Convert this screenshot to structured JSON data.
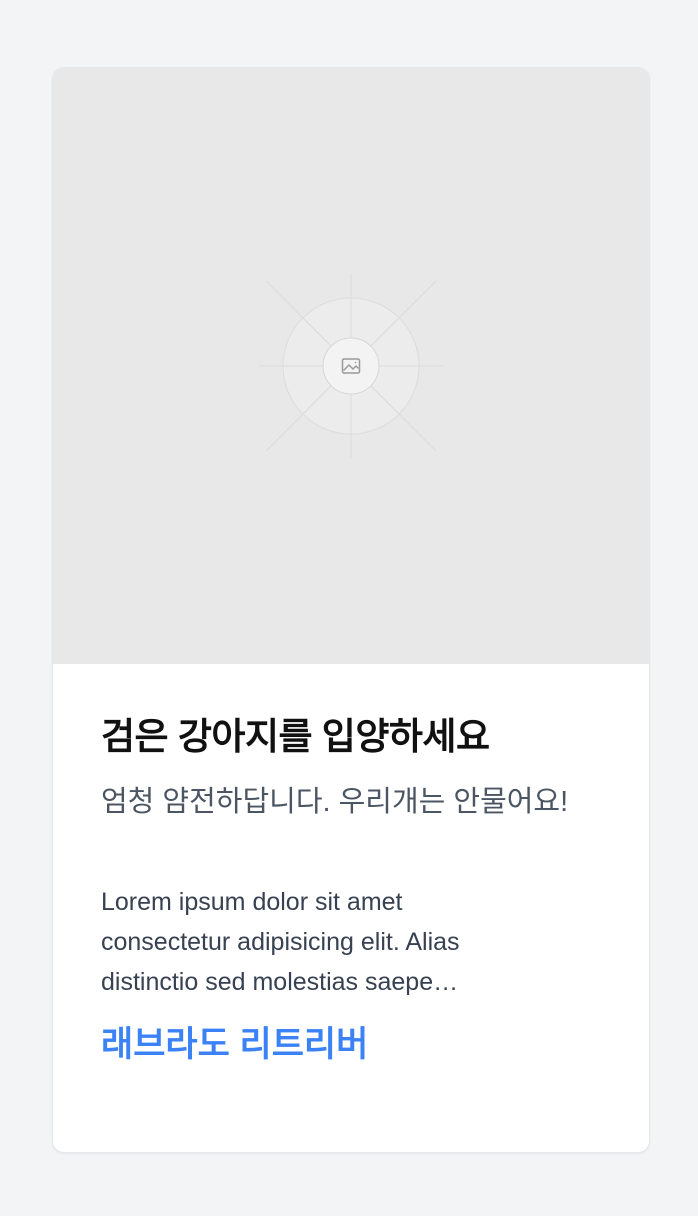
{
  "card": {
    "image_placeholder_icon": "image-icon",
    "title": "검은 강아지를 입양하세요",
    "subtitle": "엄청 얌전하답니다. 우리개는 안물어요!",
    "description_lines": [
      "Lorem ipsum dolor sit amet",
      "consectetur adipisicing elit. Alias",
      "distinctio sed molestias saepe…"
    ],
    "link_label": "래브라도 리트리버"
  },
  "colors": {
    "page_background": "#f3f4f6",
    "card_background": "#ffffff",
    "image_placeholder": "#e8e8e8",
    "title": "#111111",
    "subtitle": "#4b5563",
    "body_text": "#374151",
    "link": "#3b82f6"
  }
}
